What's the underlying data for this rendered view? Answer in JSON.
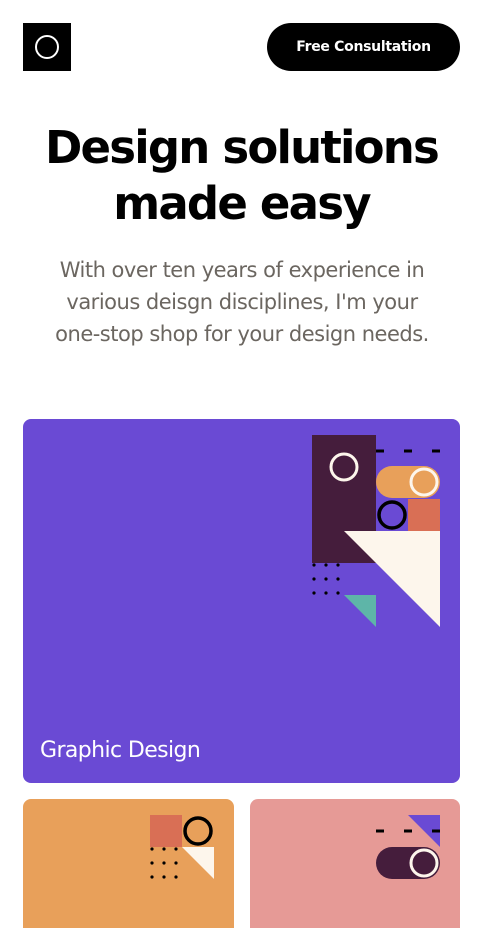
{
  "header": {
    "logo_icon": "ring-logo-icon",
    "cta_label": "Free Consultation"
  },
  "hero": {
    "title_line1": "Design solutions",
    "title_line2": "made easy",
    "description": "With over ten years of experience in various deisgn disciplines, I'm your one-stop shop for your design needs."
  },
  "services": [
    {
      "label": "Graphic Design",
      "color": "#6a4ad4"
    },
    {
      "label": "",
      "color": "#e8a05a"
    },
    {
      "label": "",
      "color": "#e69a96"
    }
  ],
  "colors": {
    "purple": "#6a4ad4",
    "dark_plum": "#451d3c",
    "orange": "#e8a05a",
    "coral": "#d96f55",
    "cream": "#fdf6ec",
    "teal": "#5eb5a8",
    "pink": "#e69a96"
  }
}
